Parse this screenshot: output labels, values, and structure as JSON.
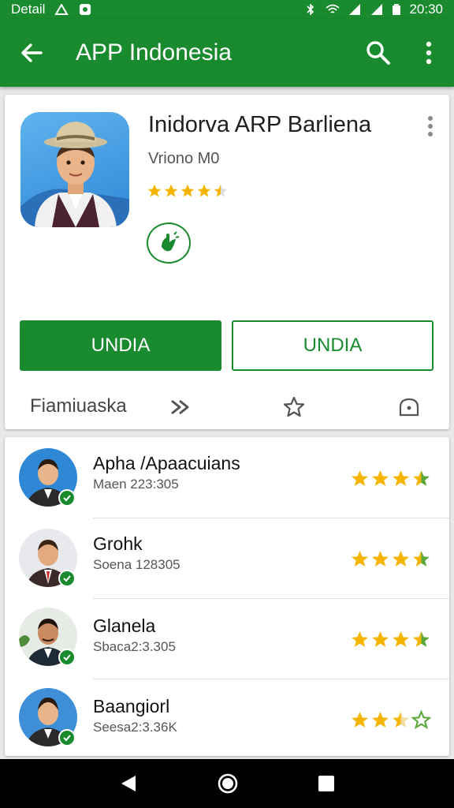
{
  "status": {
    "left_text": "Detail",
    "time": "20:30"
  },
  "appbar": {
    "title": "APP Indonesia"
  },
  "app": {
    "name": "Inidorva ARP Barliena",
    "developer": "Vriono M0",
    "rating_stars": 4.5,
    "primary_button": "UNDIA",
    "secondary_button": "UNDIA",
    "bottom_label": "Fiamiuaska"
  },
  "reviews": [
    {
      "name": "Apha /Apaacuians",
      "meta": "Maen 223:305",
      "stars": 3.5
    },
    {
      "name": "Grohk",
      "meta": "Soena 128305",
      "stars": 3.5
    },
    {
      "name": "Glanela",
      "meta": "Sbaca2:3.305",
      "stars": 3.5
    },
    {
      "name": "Baangiorl",
      "meta": "Seesa2:3.36K",
      "stars": 2.5
    }
  ],
  "colors": {
    "brand": "#1a8a2e",
    "star": "#f4b400",
    "star_green": "#5aa83a"
  },
  "icons": [
    "back-arrow-icon",
    "search-icon",
    "more-vert-icon",
    "star-icon",
    "forward-icon",
    "camera-icon",
    "back-triangle-icon",
    "home-circle-icon",
    "recents-square-icon"
  ]
}
